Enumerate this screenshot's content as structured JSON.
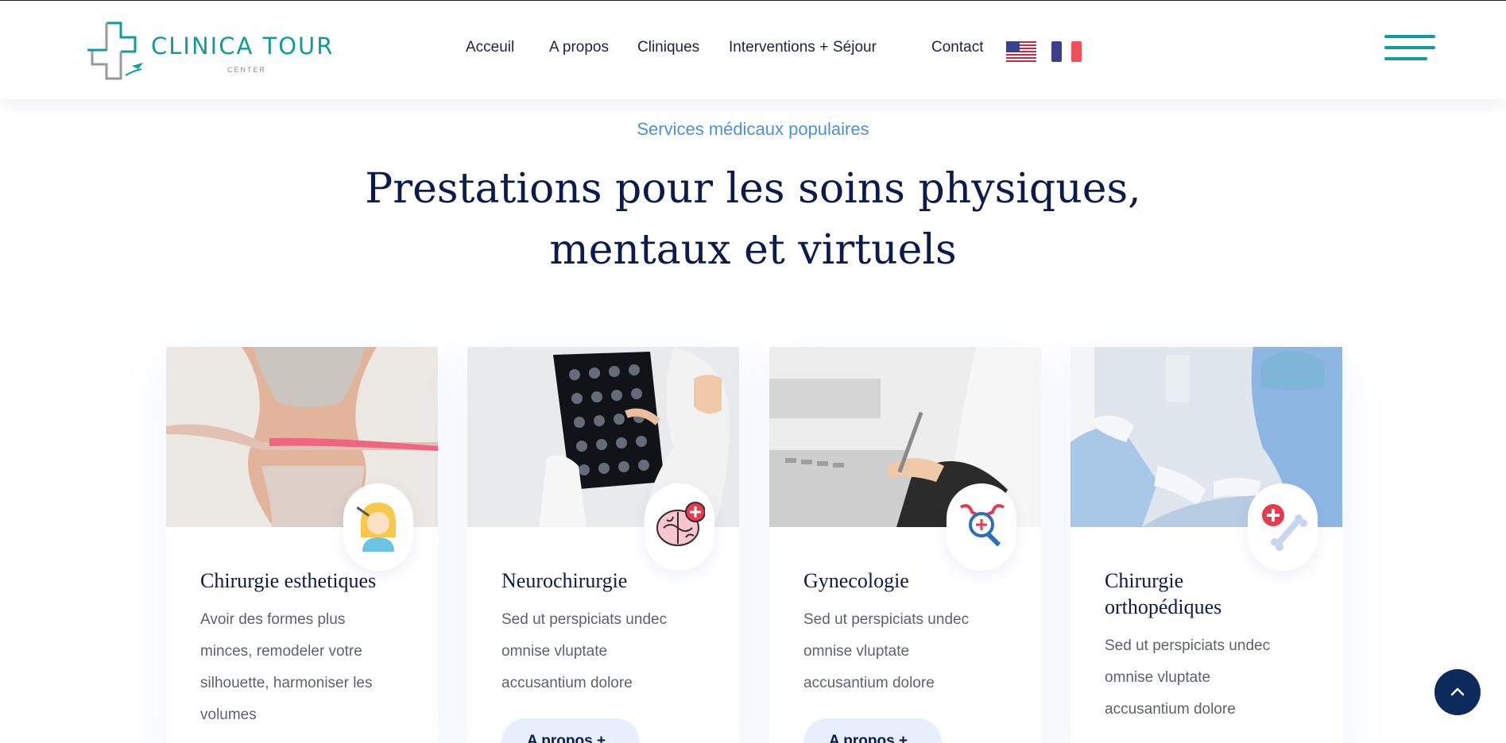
{
  "brand": {
    "name": "CLINICA TOUR",
    "tagline": "CENTER",
    "accent": "#0f9c9a"
  },
  "nav": {
    "items": [
      "Acceuil",
      "A propos",
      "Cliniques",
      "Interventions +",
      "Séjour",
      "Contact"
    ],
    "languages": [
      "us-flag-icon",
      "fr-flag-icon"
    ]
  },
  "section": {
    "eyebrow": "Services médicaux populaires",
    "title_line1": "Prestations pour les soins physiques,",
    "title_line2": "mentaux et virtuels"
  },
  "cards": [
    {
      "title": "Chirurgie esthetiques",
      "text_lines": [
        "Avoir des formes plus",
        "minces, remodeler votre",
        "silhouette, harmoniser les",
        "volumes"
      ],
      "button": "",
      "icon": "face-care-icon"
    },
    {
      "title": "Neurochirurgie",
      "text_lines": [
        "Sed ut perspiciats undec",
        "omnise vluptate",
        "accusantium dolore"
      ],
      "button": "A propos  +",
      "icon": "brain-icon"
    },
    {
      "title": "Gynecologie",
      "text_lines": [
        "Sed ut perspiciats undec",
        "omnise vluptate",
        "accusantium dolore"
      ],
      "button": "A propos  +",
      "icon": "uterus-search-icon"
    },
    {
      "title_line1": "Chirurgie",
      "title_line2": "orthopédiques",
      "text_lines": [
        "Sed ut perspiciats undec",
        "omnise vluptate",
        "accusantium dolore"
      ],
      "button": "",
      "icon": "bone-medical-icon"
    }
  ],
  "colors": {
    "heading": "#0b1b4d",
    "eyebrow": "#4a90e2",
    "button_bg": "#e6effb",
    "to_top_bg": "#0d2a5c"
  },
  "back_to_top": {
    "icon": "chevron-up-icon"
  }
}
